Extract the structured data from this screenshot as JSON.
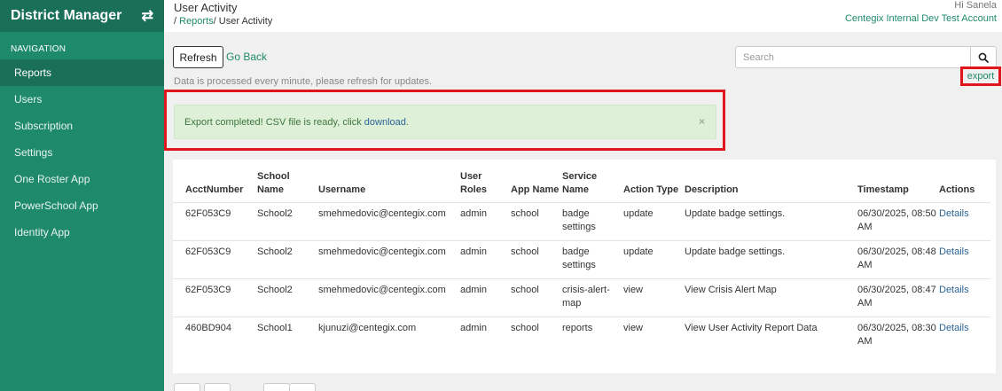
{
  "sidebar": {
    "brand": "District Manager",
    "nav_header": "NAVIGATION",
    "items": [
      {
        "label": "Reports"
      },
      {
        "label": "Users"
      },
      {
        "label": "Subscription"
      },
      {
        "label": "Settings"
      },
      {
        "label": "One Roster App"
      },
      {
        "label": "PowerSchool App"
      },
      {
        "label": "Identity App"
      }
    ],
    "active_item": "Reports"
  },
  "header": {
    "title": "User Activity",
    "breadcrumb": {
      "prefix": "/ ",
      "reports": "Reports",
      "current": "/ User Activity"
    },
    "greeting": "Hi Sanela",
    "account": "Centegix Internal Dev Test Account"
  },
  "toolbar": {
    "refresh_label": "Refresh",
    "go_back_label": "Go Back",
    "info_text": "Data is processed every minute, please refresh for updates.",
    "search_placeholder": "Search",
    "export_label": "export"
  },
  "alert": {
    "text": "Export completed! CSV file is ready, click ",
    "link": "download",
    "suffix": ".",
    "close": "×"
  },
  "table": {
    "headers": {
      "acct": "AcctNumber",
      "school": "School Name",
      "username": "Username",
      "roles": "User Roles",
      "app": "App Name",
      "service": "Service Name",
      "action": "Action Type",
      "description": "Description",
      "timestamp": "Timestamp",
      "actions": "Actions"
    },
    "rows": [
      {
        "acct": "62F053C9",
        "school": "School2",
        "username": "smehmedovic@centegix.com",
        "roles": "admin",
        "app": "school",
        "service": "badge settings",
        "action": "update",
        "description": "Update badge settings.",
        "timestamp": "06/30/2025, 08:50 AM",
        "details": "Details"
      },
      {
        "acct": "62F053C9",
        "school": "School2",
        "username": "smehmedovic@centegix.com",
        "roles": "admin",
        "app": "school",
        "service": "badge settings",
        "action": "update",
        "description": "Update badge settings.",
        "timestamp": "06/30/2025, 08:48 AM",
        "details": "Details"
      },
      {
        "acct": "62F053C9",
        "school": "School2",
        "username": "smehmedovic@centegix.com",
        "roles": "admin",
        "app": "school",
        "service": "crisis-alert-map",
        "action": "view",
        "description": "View Crisis Alert Map",
        "timestamp": "06/30/2025, 08:47 AM",
        "details": "Details"
      },
      {
        "acct": "460BD904",
        "school": "School1",
        "username": "kjunuzi@centegix.com",
        "roles": "admin",
        "app": "school",
        "service": "reports",
        "action": "view",
        "description": "View User Activity Report Data",
        "timestamp": "06/30/2025, 08:30 AM",
        "details": "Details"
      }
    ]
  },
  "colors": {
    "brand": "#1e8a6b",
    "brand_dark": "#196f57",
    "highlight": "#e0161b",
    "alert_bg": "#dff0d8"
  },
  "icons": {
    "swap": "swap-arrows-icon",
    "search": "search-icon",
    "close": "close-icon"
  }
}
